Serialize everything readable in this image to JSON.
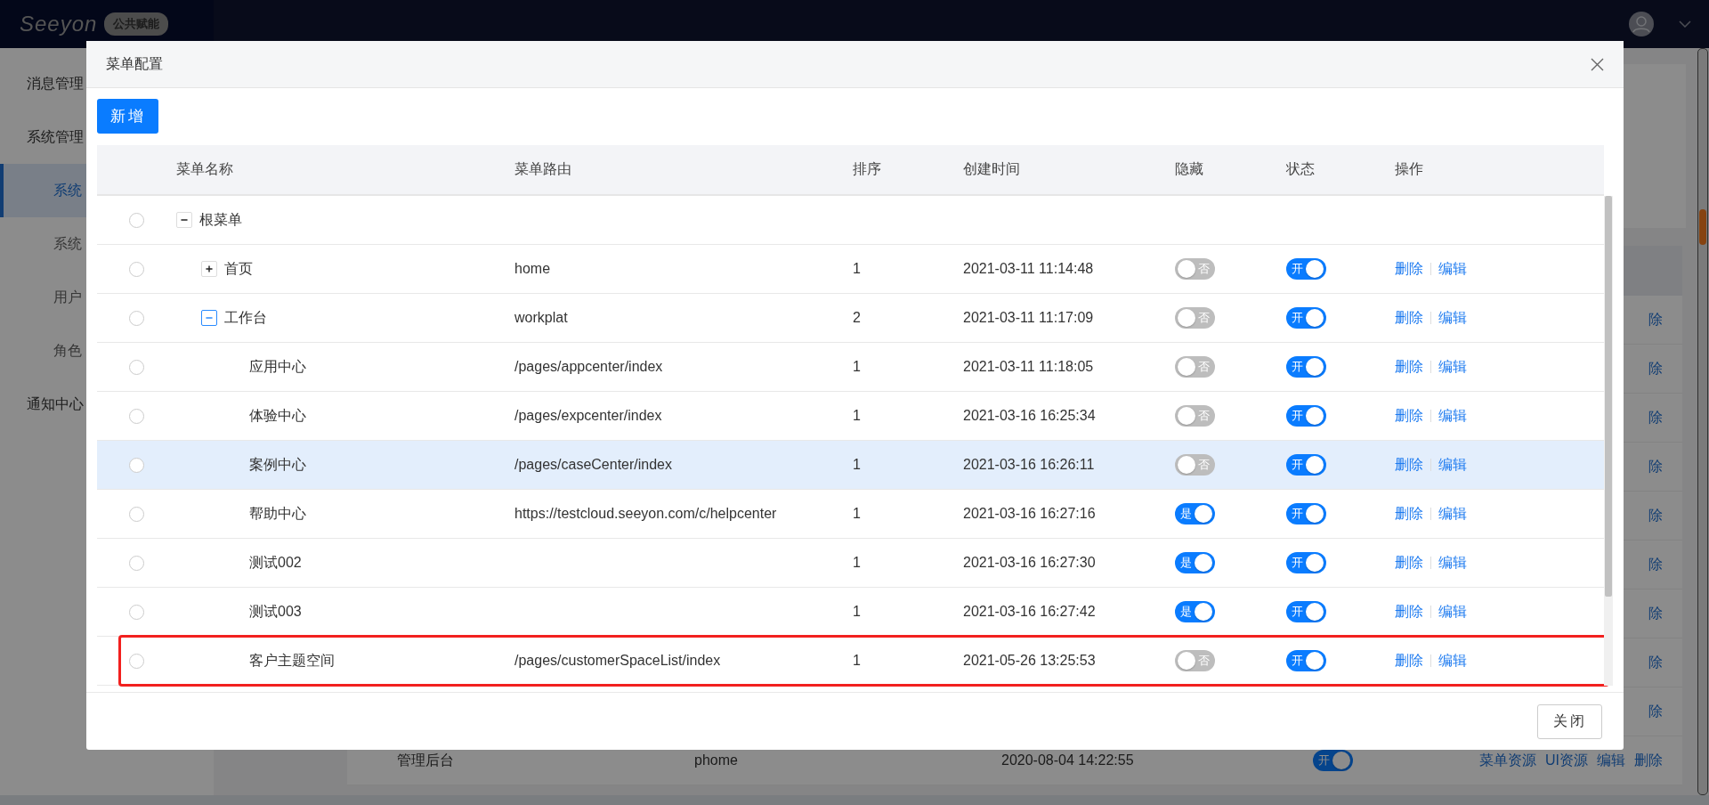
{
  "header": {
    "logo": "Seeyon",
    "badge": "公共赋能"
  },
  "sidebar": {
    "items": [
      {
        "label": "消息管理",
        "kind": "group",
        "selected": false
      },
      {
        "label": "系统管理",
        "kind": "group",
        "selected": false
      },
      {
        "label": "系统",
        "kind": "sub",
        "selected": true
      },
      {
        "label": "系统",
        "kind": "sub",
        "selected": false
      },
      {
        "label": "用户",
        "kind": "sub",
        "selected": false
      },
      {
        "label": "角色",
        "kind": "sub",
        "selected": false
      },
      {
        "label": "通知中心",
        "kind": "group",
        "selected": false
      }
    ]
  },
  "background_table": {
    "rows": [
      {
        "ops": [
          "除"
        ]
      },
      {
        "ops": [
          "除"
        ]
      },
      {
        "ops": [
          "除"
        ]
      },
      {
        "ops": [
          "除"
        ]
      },
      {
        "ops": [
          "除"
        ]
      },
      {
        "ops": [
          "除"
        ]
      },
      {
        "ops": [
          "除"
        ]
      },
      {
        "ops": [
          "除"
        ]
      },
      {
        "ops": [
          "除"
        ]
      },
      {
        "name": "管理后台",
        "route": "phome",
        "time": "2020-08-04 14:22:55",
        "status": {
          "on": true,
          "label": "开"
        },
        "ops": [
          "菜单资源",
          "UI资源",
          "编辑",
          "删除"
        ]
      }
    ]
  },
  "modal": {
    "title": "菜单配置",
    "add_button": "新增",
    "columns": [
      "菜单名称",
      "菜单路由",
      "排序",
      "创建时间",
      "隐藏",
      "状态",
      "操作"
    ],
    "rows": [
      {
        "name": "根菜单",
        "checked": false,
        "expanded": true,
        "focused": false,
        "hovered": false,
        "annotated": false,
        "children": [
          {
            "name": "首页",
            "checked": false,
            "route": "home",
            "order": "1",
            "time": "2021-03-11 11:14:48",
            "hidden": {
              "on": false,
              "label": "否"
            },
            "status": {
              "on": true,
              "label": "开"
            },
            "ops": [
              "删除",
              "编辑"
            ],
            "expanded": false,
            "focused": false,
            "hovered": false,
            "annotated": false
          },
          {
            "name": "工作台",
            "checked": false,
            "route": "workplat",
            "order": "2",
            "time": "2021-03-11 11:17:09",
            "hidden": {
              "on": false,
              "label": "否"
            },
            "status": {
              "on": true,
              "label": "开"
            },
            "ops": [
              "删除",
              "编辑"
            ],
            "expanded": true,
            "focused": true,
            "hovered": false,
            "annotated": false,
            "children": [
              {
                "name": "应用中心",
                "checked": false,
                "route": "/pages/appcenter/index",
                "order": "1",
                "time": "2021-03-11 11:18:05",
                "hidden": {
                  "on": false,
                  "label": "否"
                },
                "status": {
                  "on": true,
                  "label": "开"
                },
                "ops": [
                  "删除",
                  "编辑"
                ],
                "hovered": false,
                "annotated": false
              },
              {
                "name": "体验中心",
                "checked": false,
                "route": "/pages/expcenter/index",
                "order": "1",
                "time": "2021-03-16 16:25:34",
                "hidden": {
                  "on": false,
                  "label": "否"
                },
                "status": {
                  "on": true,
                  "label": "开"
                },
                "ops": [
                  "删除",
                  "编辑"
                ],
                "hovered": false,
                "annotated": false
              },
              {
                "name": "案例中心",
                "checked": false,
                "route": "/pages/caseCenter/index",
                "order": "1",
                "time": "2021-03-16 16:26:11",
                "hidden": {
                  "on": false,
                  "label": "否"
                },
                "status": {
                  "on": true,
                  "label": "开"
                },
                "ops": [
                  "删除",
                  "编辑"
                ],
                "hovered": true,
                "annotated": false
              },
              {
                "name": "帮助中心",
                "checked": false,
                "route": "https://testcloud.seeyon.com/c/helpcenter",
                "order": "1",
                "time": "2021-03-16 16:27:16",
                "hidden": {
                  "on": true,
                  "label": "是"
                },
                "status": {
                  "on": true,
                  "label": "开"
                },
                "ops": [
                  "删除",
                  "编辑"
                ],
                "hovered": false,
                "annotated": false
              },
              {
                "name": "测试002",
                "checked": false,
                "order": "1",
                "time": "2021-03-16 16:27:30",
                "hidden": {
                  "on": true,
                  "label": "是"
                },
                "status": {
                  "on": true,
                  "label": "开"
                },
                "ops": [
                  "删除",
                  "编辑"
                ],
                "hovered": false,
                "annotated": false
              },
              {
                "name": "测试003",
                "checked": false,
                "order": "1",
                "time": "2021-03-16 16:27:42",
                "hidden": {
                  "on": true,
                  "label": "是"
                },
                "status": {
                  "on": true,
                  "label": "开"
                },
                "ops": [
                  "删除",
                  "编辑"
                ],
                "hovered": false,
                "annotated": false
              },
              {
                "name": "客户主题空间",
                "checked": false,
                "route": "/pages/customerSpaceList/index",
                "order": "1",
                "time": "2021-05-26 13:25:53",
                "hidden": {
                  "on": false,
                  "label": "否"
                },
                "status": {
                  "on": true,
                  "label": "开"
                },
                "ops": [
                  "删除",
                  "编辑"
                ],
                "hovered": false,
                "annotated": true
              }
            ]
          }
        ]
      }
    ],
    "close_button": "关闭"
  }
}
